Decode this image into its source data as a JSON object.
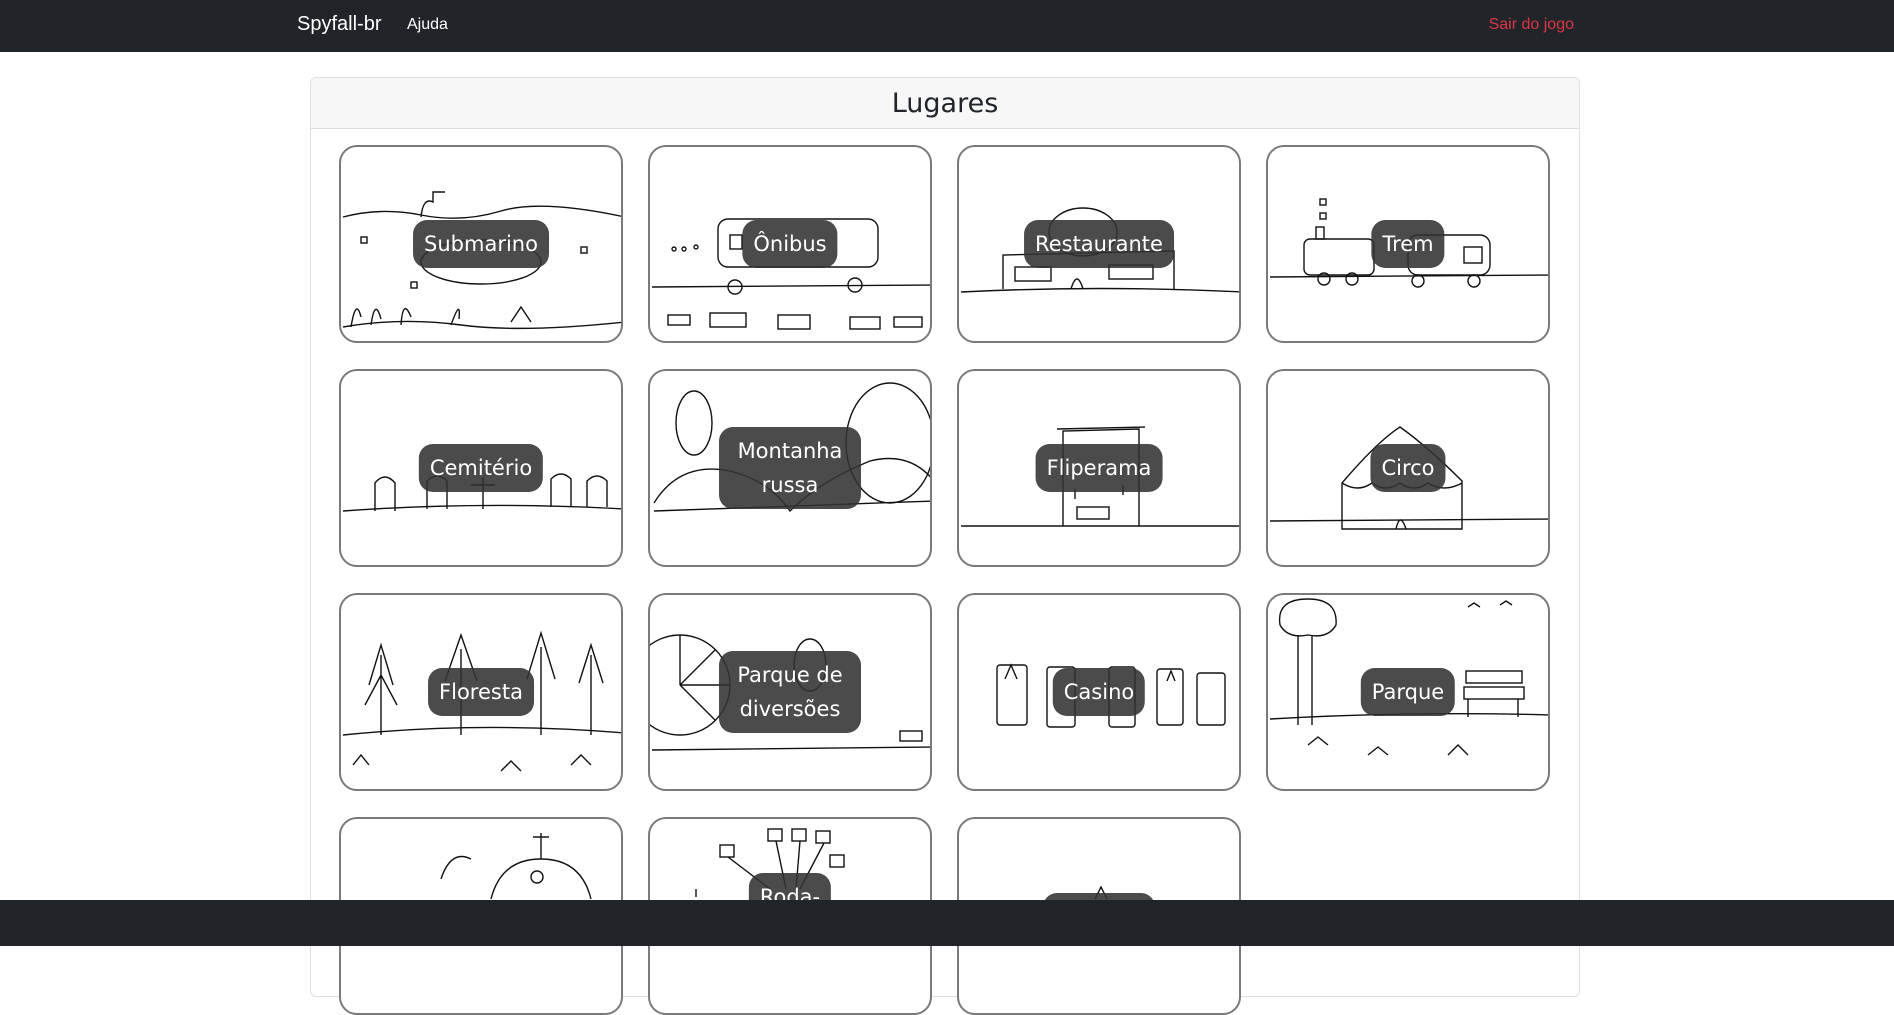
{
  "navbar": {
    "brand": "Spyfall-br",
    "help_label": "Ajuda",
    "exit_label": "Sair do jogo",
    "exit_color": "#dc3545"
  },
  "card": {
    "title": "Lugares"
  },
  "places": [
    {
      "label": "Submarino"
    },
    {
      "label": "Ônibus"
    },
    {
      "label": "Restaurante"
    },
    {
      "label": "Trem"
    },
    {
      "label": "Cemitério"
    },
    {
      "label": "Montanha russa"
    },
    {
      "label": "Fliperama"
    },
    {
      "label": "Circo"
    },
    {
      "label": "Floresta"
    },
    {
      "label": "Parque de diversões"
    },
    {
      "label": "Casino"
    },
    {
      "label": "Parque"
    },
    {
      "label": ""
    },
    {
      "label": "Roda-"
    },
    {
      "label": ""
    }
  ],
  "colors": {
    "navbar_bg": "#212529",
    "tile_border": "#7a7a7a",
    "label_bg": "#323232"
  }
}
